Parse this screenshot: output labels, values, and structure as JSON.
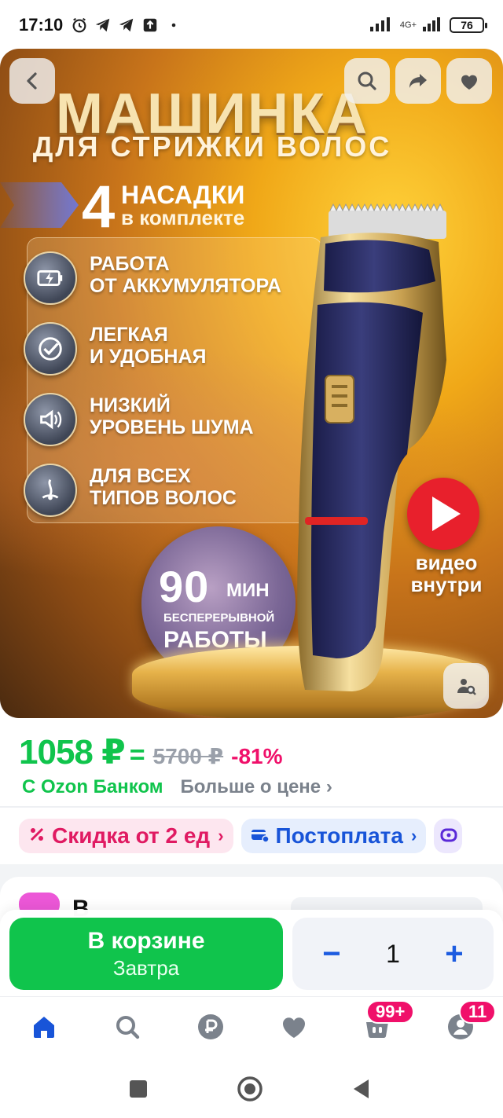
{
  "status_bar": {
    "time": "17:10",
    "network": "4G+",
    "battery": "76"
  },
  "hero": {
    "title": "МАШИНКА",
    "subtitle": "ДЛЯ СТРИЖКИ ВОЛОС",
    "nozzles_count": "4",
    "nozzles_line1": "НАСАДКИ",
    "nozzles_line2": "в комплекте",
    "features": [
      {
        "line1": "РАБОТА",
        "line2": "ОТ АККУМУЛЯТОРА",
        "icon": "battery-charge-icon"
      },
      {
        "line1": "ЛЕГКАЯ",
        "line2": "И УДОБНАЯ",
        "icon": "checkmark-icon"
      },
      {
        "line1": "НИЗКИЙ",
        "line2": "УРОВЕНЬ ШУМА",
        "icon": "speaker-icon"
      },
      {
        "line1": "ДЛЯ ВСЕХ",
        "line2": "ТИПОВ ВОЛОС",
        "icon": "hair-follicle-icon"
      }
    ],
    "badge_number": "90",
    "badge_unit": "МИН",
    "badge_line1": "БЕСПЕРЕРЫВНОЙ",
    "badge_line2": "РАБОТЫ",
    "video_line1": "видео",
    "video_line2": "внутри"
  },
  "price": {
    "current": "1058 ₽",
    "original": "5700 ₽",
    "discount": "-81%",
    "bank_label": "С Ozon Банком",
    "more_label": "Больше о цене ›"
  },
  "chips": [
    {
      "label": "Скидка от 2 ед",
      "icon": "percent-icon"
    },
    {
      "label": "Постоплата",
      "icon": "card-icon"
    }
  ],
  "peek": {
    "partial_text": "В"
  },
  "purchase": {
    "cart_label": "В корзине",
    "delivery_label": "Завтра",
    "quantity": "1",
    "minus": "−",
    "plus": "+"
  },
  "tabs": {
    "cart_badge": "99+",
    "profile_badge": "11"
  },
  "colors": {
    "accent_green": "#10c44c",
    "discount_pink": "#f0106a",
    "link_blue": "#1c5be0"
  }
}
